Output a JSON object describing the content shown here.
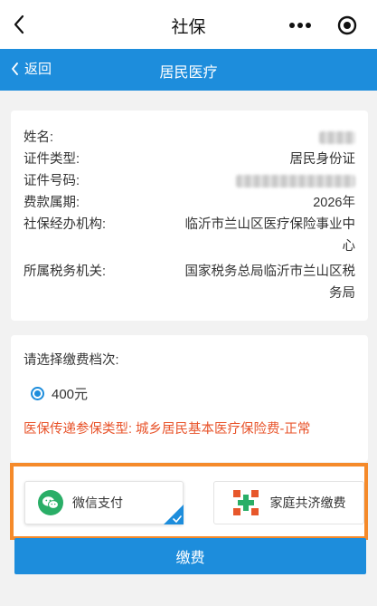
{
  "topbar": {
    "title": "社保"
  },
  "header": {
    "back_label": "返回",
    "title": "居民医疗"
  },
  "info": {
    "rows": [
      {
        "label": "姓名:",
        "value": ""
      },
      {
        "label": "证件类型:",
        "value": "居民身份证"
      },
      {
        "label": "证件号码:",
        "value": ""
      },
      {
        "label": "费款属期:",
        "value": "2026年"
      },
      {
        "label": "社保经办机构:",
        "value_line1": "临沂市兰山区医疗保险事业中",
        "value_line2": "心"
      },
      {
        "label": "所属税务机关:",
        "value_line1": "国家税务总局临沂市兰山区税",
        "value_line2": "务局"
      }
    ]
  },
  "tier": {
    "prompt": "请选择缴费档次:",
    "option": "400元",
    "selected": true,
    "notice": "医保传递参保类型: 城乡居民基本医疗保险费-正常"
  },
  "payment": {
    "options": [
      {
        "label": "微信支付",
        "icon": "wechat-icon",
        "selected": true
      },
      {
        "label": "家庭共济缴费",
        "icon": "family-share-icon",
        "selected": false
      }
    ],
    "highlight_color": "#f58a2a"
  },
  "submit": {
    "label": "缴费"
  },
  "colors": {
    "accent": "#1d8ddc",
    "warning": "#e8532a",
    "wechat": "#2aae67"
  }
}
